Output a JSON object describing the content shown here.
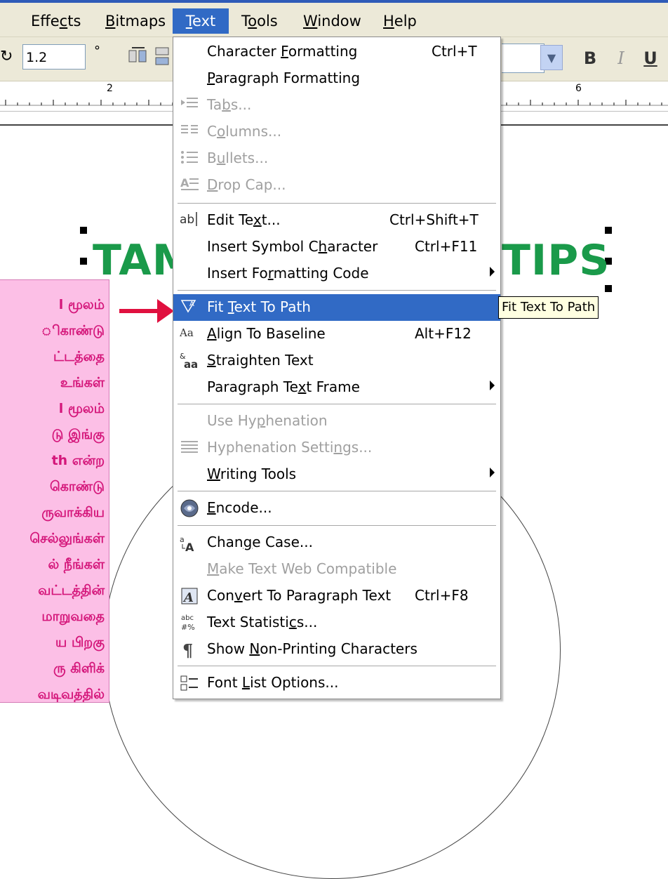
{
  "menubar": {
    "items": [
      {
        "label": "Effects",
        "pre": "Effe",
        "acc": "c",
        "post": "ts"
      },
      {
        "label": "Bitmaps",
        "pre": "",
        "acc": "B",
        "post": "itmaps"
      },
      {
        "label": "Text",
        "pre": "",
        "acc": "T",
        "post": "ext"
      },
      {
        "label": "Tools",
        "pre": "T",
        "acc": "o",
        "post": "ols"
      },
      {
        "label": "Window",
        "pre": "",
        "acc": "W",
        "post": "indow"
      },
      {
        "label": "Help",
        "pre": "",
        "acc": "H",
        "post": "elp"
      }
    ],
    "active": "Text"
  },
  "toolbar": {
    "rotation_value": "1.2",
    "degree_symbol": "°",
    "bold": "B",
    "italic": "I",
    "underline": "U"
  },
  "ruler": {
    "ticks": [
      "2",
      "6"
    ]
  },
  "canvas": {
    "title_left": "TAM",
    "title_right": "TIPS",
    "tamil_lines": [
      "l மூலம்",
      "ிகாண்டு",
      "ட்டத்தை",
      "உங்கள்",
      "l மூலம்",
      "டு இங்கு",
      "th என்ற",
      "கொண்டு",
      "ருவாக்கிய",
      "செல்லுங்கள்",
      "ல் நீங்கள்",
      "வட்டத்தின்",
      "மாறுவதை",
      "ய பிறகு",
      "ரு கிளிக்",
      "வடிவத்தில்"
    ]
  },
  "menu": {
    "items": [
      {
        "pre": "Character ",
        "acc": "F",
        "post": "ormatting",
        "shortcut": "Ctrl+T",
        "icon": "",
        "disabled": false,
        "sub": false,
        "hl": false
      },
      {
        "pre": "",
        "acc": "P",
        "post": "aragraph Formatting",
        "shortcut": "",
        "icon": "",
        "disabled": false,
        "sub": false,
        "hl": false
      },
      {
        "pre": "Ta",
        "acc": "b",
        "post": "s...",
        "shortcut": "",
        "icon": "tabs-icon",
        "disabled": true,
        "sub": false,
        "hl": false
      },
      {
        "pre": "C",
        "acc": "o",
        "post": "lumns...",
        "shortcut": "",
        "icon": "columns-icon",
        "disabled": true,
        "sub": false,
        "hl": false
      },
      {
        "pre": "B",
        "acc": "u",
        "post": "llets...",
        "shortcut": "",
        "icon": "bullets-icon",
        "disabled": true,
        "sub": false,
        "hl": false
      },
      {
        "pre": "",
        "acc": "D",
        "post": "rop Cap...",
        "shortcut": "",
        "icon": "drop-cap-icon",
        "disabled": true,
        "sub": false,
        "hl": false
      },
      {
        "pre": "Edit Te",
        "acc": "x",
        "post": "t...",
        "shortcut": "Ctrl+Shift+T",
        "icon": "edit-text-icon",
        "disabled": false,
        "sub": false,
        "hl": false
      },
      {
        "pre": "Insert Symbol C",
        "acc": "h",
        "post": "aracter",
        "shortcut": "Ctrl+F11",
        "icon": "",
        "disabled": false,
        "sub": false,
        "hl": false
      },
      {
        "pre": "Insert Fo",
        "acc": "r",
        "post": "matting Code",
        "shortcut": "",
        "icon": "",
        "disabled": false,
        "sub": true,
        "hl": false
      },
      {
        "pre": "Fit ",
        "acc": "T",
        "post": "ext To Path",
        "shortcut": "",
        "icon": "fit-text-to-path-icon",
        "disabled": false,
        "sub": false,
        "hl": true
      },
      {
        "pre": "",
        "acc": "A",
        "post": "lign To Baseline",
        "shortcut": "Alt+F12",
        "icon": "align-baseline-icon",
        "disabled": false,
        "sub": false,
        "hl": false
      },
      {
        "pre": "",
        "acc": "S",
        "post": "traighten Text",
        "shortcut": "",
        "icon": "straighten-text-icon",
        "disabled": false,
        "sub": false,
        "hl": false
      },
      {
        "pre": "Paragraph Te",
        "acc": "x",
        "post": "t Frame",
        "shortcut": "",
        "icon": "",
        "disabled": false,
        "sub": true,
        "hl": false
      },
      {
        "pre": "Use Hy",
        "acc": "p",
        "post": "henation",
        "shortcut": "",
        "icon": "",
        "disabled": true,
        "sub": false,
        "hl": false
      },
      {
        "pre": "Hyphenation Setti",
        "acc": "n",
        "post": "gs...",
        "shortcut": "",
        "icon": "hyphenation-settings-icon",
        "disabled": true,
        "sub": false,
        "hl": false
      },
      {
        "pre": "",
        "acc": "W",
        "post": "riting Tools",
        "shortcut": "",
        "icon": "",
        "disabled": false,
        "sub": true,
        "hl": false
      },
      {
        "pre": "",
        "acc": "E",
        "post": "ncode...",
        "shortcut": "",
        "icon": "encode-icon",
        "disabled": false,
        "sub": false,
        "hl": false
      },
      {
        "pre": "Chan",
        "acc": "g",
        "post": "e Case...",
        "shortcut": "",
        "icon": "change-case-icon",
        "disabled": false,
        "sub": false,
        "hl": false
      },
      {
        "pre": "",
        "acc": "M",
        "post": "ake Text Web Compatible",
        "shortcut": "",
        "icon": "",
        "disabled": true,
        "sub": false,
        "hl": false
      },
      {
        "pre": "Con",
        "acc": "v",
        "post": "ert To Paragraph Text",
        "shortcut": "Ctrl+F8",
        "icon": "convert-paragraph-icon",
        "disabled": false,
        "sub": false,
        "hl": false
      },
      {
        "pre": "Text Statisti",
        "acc": "c",
        "post": "s...",
        "shortcut": "",
        "icon": "text-statistics-icon",
        "disabled": false,
        "sub": false,
        "hl": false
      },
      {
        "pre": "Show ",
        "acc": "N",
        "post": "on-Printing Characters",
        "shortcut": "",
        "icon": "pilcrow-icon",
        "disabled": false,
        "sub": false,
        "hl": false
      },
      {
        "pre": "Font ",
        "acc": "L",
        "post": "ist Options...",
        "shortcut": "",
        "icon": "font-list-icon",
        "disabled": false,
        "sub": false,
        "hl": false
      }
    ]
  },
  "tooltip": "Fit Text To Path",
  "colors": {
    "menu_highlight": "#316ac5",
    "title_green": "#1a9a4a",
    "pink_box": "#fcbfe6",
    "tamil_text": "#d4167a",
    "arrow": "#e0103f"
  }
}
